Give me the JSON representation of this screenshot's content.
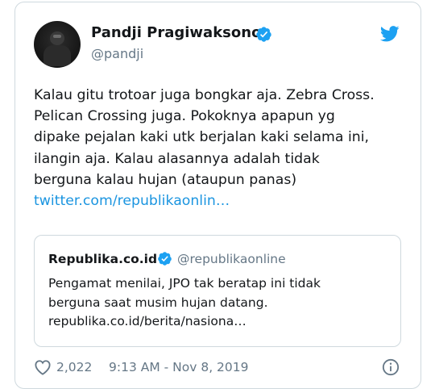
{
  "colors": {
    "link": "#1b95e0",
    "secondary_text": "#657786",
    "verified": "#1da1f2"
  },
  "author": {
    "name": "Pandji Pragiwaksono",
    "handle": "@pandji",
    "verified_icon": "verified-badge-icon",
    "avatar": "profile-photo"
  },
  "brand_icon": "twitter-bird-icon",
  "tweet": {
    "lines": [
      "Kalau gitu trotoar juga bongkar aja. Zebra Cross.",
      "Pelican Crossing juga. Pokoknya apapun yg",
      "dipake pejalan kaki utk berjalan kaki selama ini,",
      "ilangin aja. Kalau alasannya adalah tidak",
      "berguna kalau hujan (ataupun panas)"
    ],
    "link": "twitter.com/republikaonlin…"
  },
  "quoted": {
    "name": "Republika.co.id",
    "handle": "@republikaonline",
    "lines": [
      "Pengamat menilai, JPO tak beratap ini tidak",
      "berguna saat musim hujan datang.",
      "republika.co.id/berita/nasiona…"
    ]
  },
  "footer": {
    "likes": "2,022",
    "timestamp": "9:13 AM - Nov 8, 2019",
    "like_icon": "heart-icon",
    "info_icon": "info-icon"
  }
}
